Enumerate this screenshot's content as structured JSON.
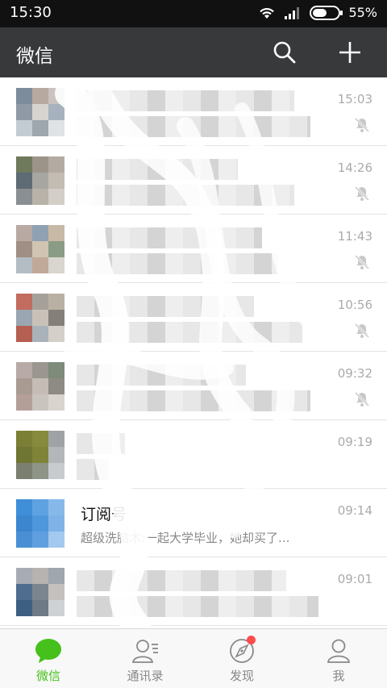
{
  "status_bar": {
    "time": "15:30",
    "battery": "55%",
    "battery_level": 0.55
  },
  "app_bar": {
    "title": "微信",
    "search_icon": "search-icon",
    "add_icon": "plus-icon"
  },
  "chats": [
    {
      "name": "",
      "preview": "",
      "time": "15:03",
      "muted": true
    },
    {
      "name": "",
      "preview": "",
      "time": "14:26",
      "muted": true
    },
    {
      "name": "",
      "preview": "",
      "time": "11:43",
      "muted": true
    },
    {
      "name": "",
      "preview": "",
      "time": "10:56",
      "muted": true
    },
    {
      "name": "",
      "preview": "",
      "time": "09:32",
      "muted": true
    },
    {
      "name": "",
      "preview": "",
      "time": "09:19",
      "muted": false
    },
    {
      "name": "订阅号",
      "preview": "超级洗脑术:一起大学毕业，她却买了...",
      "time": "09:14",
      "muted": false
    },
    {
      "name": "",
      "preview": "",
      "time": "09:01",
      "muted": false
    }
  ],
  "tabs": [
    {
      "label": "微信",
      "icon": "chat-bubble-icon",
      "active": true
    },
    {
      "label": "通讯录",
      "icon": "contacts-icon",
      "active": false
    },
    {
      "label": "发现",
      "icon": "compass-icon",
      "active": false,
      "badge": true
    },
    {
      "label": "我",
      "icon": "person-icon",
      "active": false
    }
  ],
  "colors": {
    "accent": "#46c01b",
    "app_bar": "#37393b",
    "badge": "#fb4d4d"
  }
}
